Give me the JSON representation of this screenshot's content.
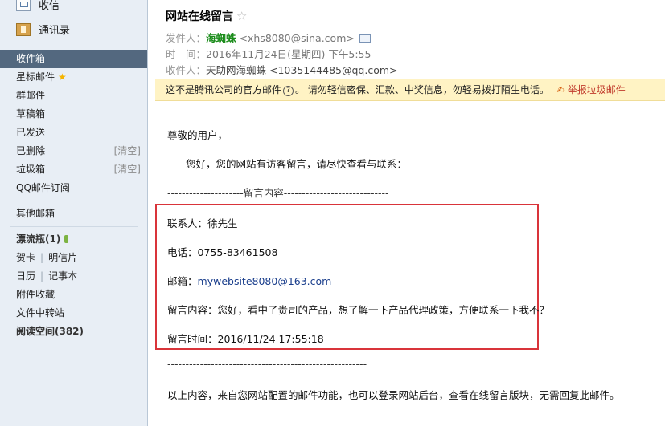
{
  "sidebar": {
    "inbox_label": "收信",
    "contacts_label": "通讯录",
    "folders": [
      {
        "label": "收件箱"
      },
      {
        "label": "星标邮件"
      },
      {
        "label": "群邮件"
      },
      {
        "label": "草稿箱"
      },
      {
        "label": "已发送"
      },
      {
        "label": "已删除",
        "action": "[清空]"
      },
      {
        "label": "垃圾箱",
        "action": "[清空]"
      },
      {
        "label": "QQ邮件订阅"
      }
    ],
    "other_mailbox": "其他邮箱",
    "drift_bottle": "漂流瓶(1)",
    "greeting_card": "贺卡",
    "postcard": "明信片",
    "calendar": "日历",
    "notepad": "记事本",
    "attachments": "附件收藏",
    "file_transfer": "文件中转站",
    "reading_space": "阅读空间(382)",
    "separator": "|"
  },
  "mail": {
    "subject": "网站在线留言",
    "star": "☆",
    "from_label": "发件人：",
    "from_name": "海蜘蛛",
    "from_address": "<xhs8080@sina.com>",
    "time_label": "时　间：",
    "time_value": "2016年11月24日(星期四) 下午5:55",
    "to_label": "收件人：",
    "to_value": "天助网海蜘蛛 <1035144485@qq.com>"
  },
  "warning": {
    "text_before": "这不是腾讯公司的官方邮件",
    "help": "?",
    "text_after": "。 请勿轻信密保、汇款、中奖信息，勿轻易拨打陌生电话。",
    "report_icon": "✍",
    "report_label": "举报垃圾邮件"
  },
  "content": {
    "greeting": "尊敬的用户，",
    "intro": "您好，您的网站有访客留言，请尽快查看与联系：",
    "divider_top": "---------------------留言内容-----------------------------",
    "contact": "联系人：徐先生",
    "phone": "电话：0755-83461508",
    "email_label": "邮箱：",
    "email_value": "mywebsite8080@163.com",
    "message": "留言内容：您好，看中了贵司的产品，想了解一下产品代理政策，方便联系一下我不？",
    "time": "留言时间：2016/11/24 17:55:18",
    "divider_bottom": "-------------------------------------------------------",
    "footer": "以上内容，来自您网站配置的邮件功能，也可以登录网站后台，查看在线留言版块，无需回复此邮件。"
  },
  "colors": {
    "sidebar_bg": "#e8eef5",
    "active_folder": "#53687f",
    "sender_green": "#1a8c1a",
    "warning_bg": "#fff3c4",
    "highlight_red": "#d9343a"
  }
}
